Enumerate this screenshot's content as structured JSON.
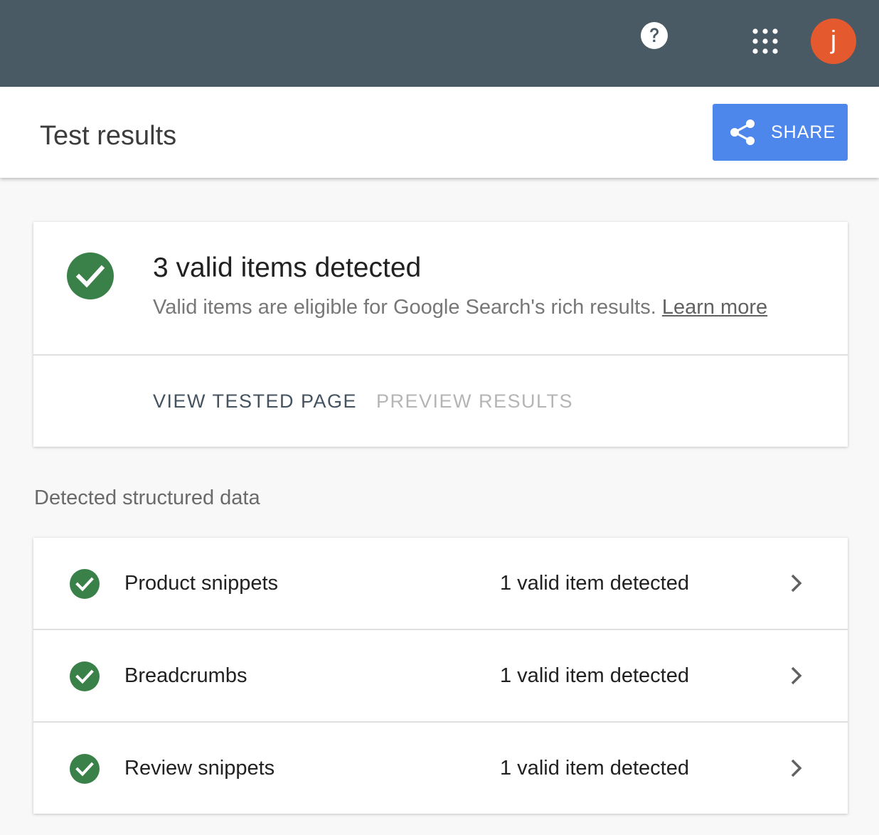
{
  "topbar": {
    "background_color": "#4a5a65",
    "help_icon": "help-circle-icon",
    "apps_icon": "apps-grid-icon",
    "avatar_initial": "j",
    "avatar_color": "#e5592f"
  },
  "header": {
    "title": "Test results",
    "share_label": "SHARE",
    "share_icon": "share-icon",
    "share_color": "#4d87ec"
  },
  "summary": {
    "icon": "check-circle-icon",
    "status_color": "#3a8049",
    "title": "3 valid items detected",
    "description": "Valid items are eligible for Google Search's rich results.",
    "learn_more": "Learn more",
    "tabs": [
      {
        "label": "VIEW TESTED PAGE",
        "enabled": true
      },
      {
        "label": "PREVIEW RESULTS",
        "enabled": false
      }
    ]
  },
  "structured_data": {
    "heading": "Detected structured data",
    "items": [
      {
        "name": "Product snippets",
        "status": "1 valid item detected",
        "icon": "check-circle-icon",
        "action_icon": "chevron-right-icon"
      },
      {
        "name": "Breadcrumbs",
        "status": "1 valid item detected",
        "icon": "check-circle-icon",
        "action_icon": "chevron-right-icon"
      },
      {
        "name": "Review snippets",
        "status": "1 valid item detected",
        "icon": "check-circle-icon",
        "action_icon": "chevron-right-icon"
      }
    ]
  }
}
